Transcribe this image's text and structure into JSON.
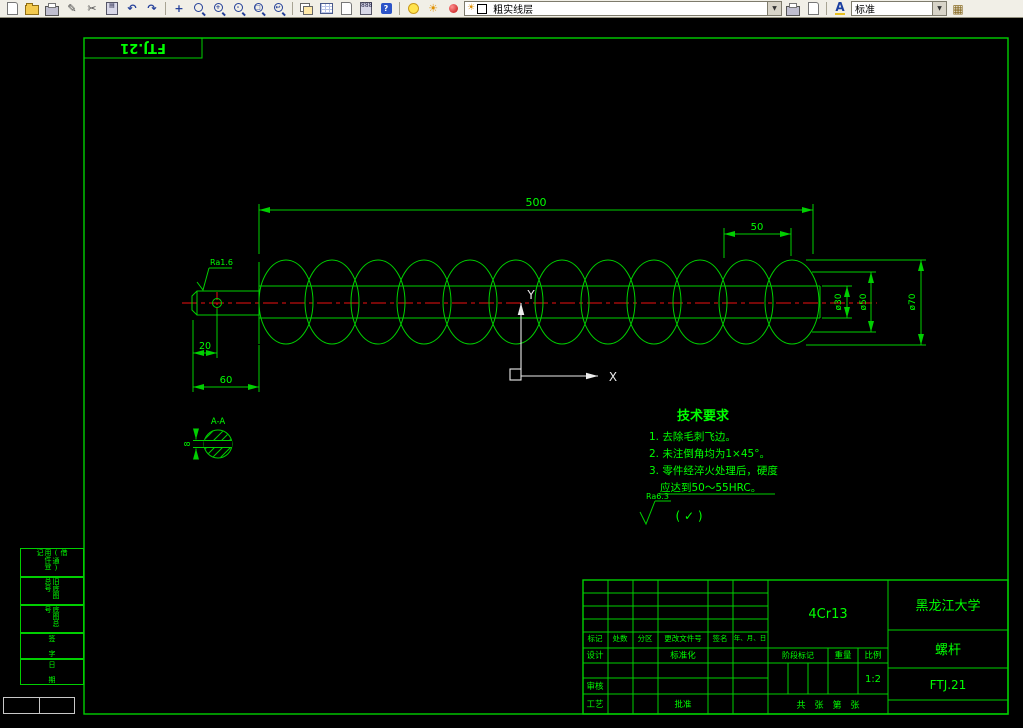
{
  "colors": {
    "line_green": "#00cf00",
    "text_green": "#00ff00",
    "centerline_red": "#ee1010",
    "toolbar_bg": "#f1efe7",
    "canvas_bg": "#000000"
  },
  "toolbar": {
    "layer_dropdown": "粗实线层",
    "style_dropdown": "标准",
    "icons": [
      "new-doc-icon",
      "open-folder-icon",
      "print-icon",
      "pencil-icon",
      "scissors-icon",
      "clipboard-icon",
      "undo-icon",
      "redo-icon",
      "pan-icon",
      "zoom-realtime-icon",
      "zoom-in-icon",
      "zoom-out-icon",
      "zoom-window-icon",
      "zoom-previous-icon",
      "layer-properties-icon",
      "grid-table-icon",
      "sheet-icon",
      "calculator-icon",
      "help-icon",
      "light-bulb-icon",
      "sun-icon",
      "red-sphere-icon",
      "layer-color-chip-icon",
      "chevron-down-icon",
      "plot-icon",
      "plot-preview-icon",
      "text-style-icon",
      "palette-icon"
    ]
  },
  "drawing": {
    "corner_label": "FTJ.21",
    "dims": {
      "length": "500",
      "pitch": "50",
      "dia_core": "ø30",
      "dia_mid": "ø50",
      "dia_outer": "ø70",
      "hole_offset": "20",
      "shank_length": "60",
      "section_width": "8"
    },
    "axes": {
      "x": "X",
      "y": "Y"
    },
    "section_label": "A-A",
    "roughness": {
      "shaft": "Ra1.6",
      "general": "Ra6.3",
      "paren": "( ✓ )"
    },
    "tech": {
      "title": "技术要求",
      "items": [
        "1. 去除毛刺飞边。",
        "2. 未注倒角均为1×45°。",
        "3. 零件经淬火处理后，硬度",
        "应达到50～55HRC。"
      ]
    }
  },
  "title_block": {
    "material": "4Cr13",
    "org": "黑龙江大学",
    "part": "螺杆",
    "dwg_no": "FTJ.21",
    "scale_value": "1:2",
    "sheet_row": "共　张　第　张",
    "labels": {
      "mark": "标记",
      "count": "处数",
      "zone": "分区",
      "change_doc": "更改文件号",
      "sign": "签名",
      "date": "年、月、日",
      "design": "设计",
      "standardize": "标准化",
      "check": "审核",
      "process": "工艺",
      "approve": "批准",
      "stage": "阶段标记",
      "weight": "重量",
      "scale": "比例"
    }
  },
  "left_strip": {
    "borrow": "借(通)用件登记",
    "old_no": "旧底图总号",
    "base_no": "底图总号",
    "sign": "签 字",
    "date": "日 期"
  }
}
